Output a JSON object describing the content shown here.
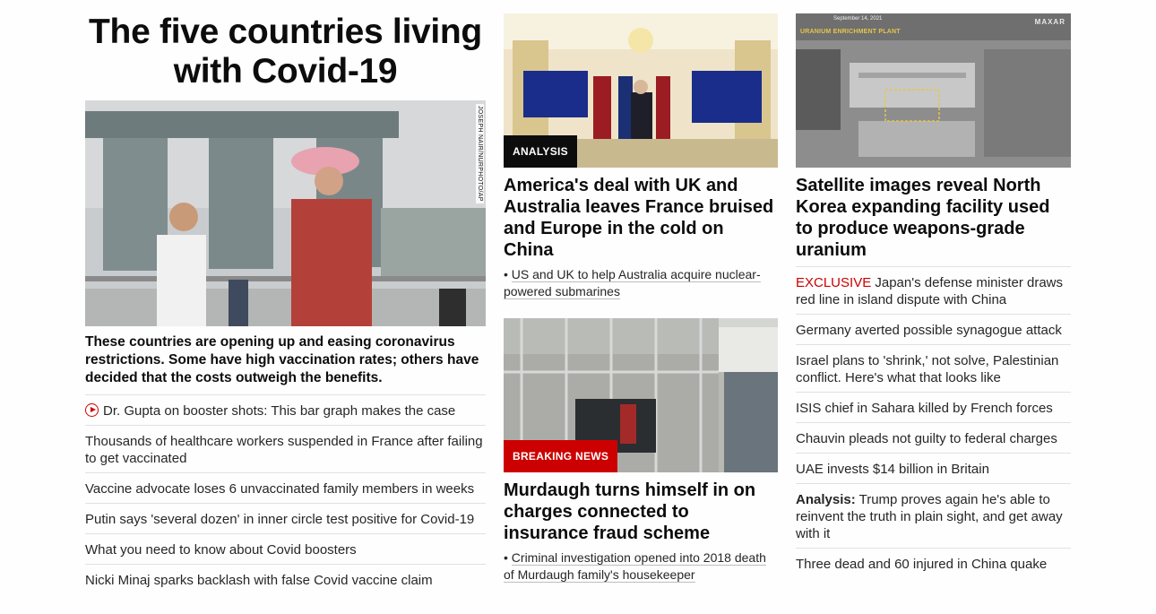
{
  "column1": {
    "title": "The five countries living with Covid-19",
    "photo_credit": "JOSEPH NAIR/NURPHOTO/AP",
    "description": "These countries are opening up and easing coronavirus restrictions. Some have high vaccination rates; others have decided that the costs outweigh the benefits.",
    "links": [
      "Dr. Gupta on booster shots: This bar graph makes the case",
      "Thousands of healthcare workers suspended in France after failing to get vaccinated",
      "Vaccine advocate loses 6 unvaccinated family members in weeks",
      "Putin says 'several dozen' in inner circle test positive for Covid-19",
      "What you need to know about Covid boosters",
      "Nicki Minaj sparks backlash with false Covid vaccine claim"
    ]
  },
  "column2": {
    "story1": {
      "label": "ANALYSIS",
      "headline": "America's deal with UK and Australia leaves France bruised and Europe in the cold on China",
      "bullet": "US and UK to help Australia acquire nuclear-powered submarines"
    },
    "story2": {
      "label": "BREAKING NEWS",
      "headline": "Murdaugh turns himself in on charges connected to insurance fraud scheme",
      "bullet": "Criminal investigation opened into 2018 death of Murdaugh family's housekeeper"
    }
  },
  "column3": {
    "image_caption": "URANIUM ENRICHMENT PLANT",
    "image_date": "September 14, 2021",
    "image_brand": "MAXAR",
    "headline": "Satellite images reveal North Korea expanding facility used to produce weapons-grade uranium",
    "links": [
      {
        "prefix": "EXCLUSIVE",
        "text": "Japan's defense minister draws red line in island dispute with China"
      },
      {
        "prefix": "",
        "text": "Germany averted possible synagogue attack"
      },
      {
        "prefix": "",
        "text": "Israel plans to 'shrink,' not solve, Palestinian conflict. Here's what that looks like"
      },
      {
        "prefix": "",
        "text": "ISIS chief in Sahara killed by French forces"
      },
      {
        "prefix": "",
        "text": "Chauvin pleads not guilty to federal charges"
      },
      {
        "prefix": "",
        "text": "UAE invests $14 billion in Britain"
      },
      {
        "prefix": "Analysis:",
        "text": "Trump proves again he's able to reinvent the truth in plain sight, and get away with it"
      },
      {
        "prefix": "",
        "text": "Three dead and 60 injured in China quake"
      }
    ]
  },
  "colors": {
    "accent_red": "#cc0000",
    "label_dark": "#0c0c0c",
    "divider": "#e1e1e1"
  }
}
